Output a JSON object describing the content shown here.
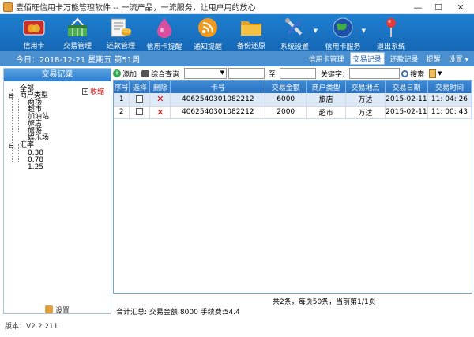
{
  "window": {
    "title": "壹佰旺信用卡万能管理软件 -- 一流产品，一流服务，让用户用的放心",
    "minimize": "—",
    "maximize": "☐",
    "close": "✕"
  },
  "toolbar": {
    "items": [
      {
        "label": "信用卡",
        "icon": "credit-card-icon",
        "has_menu": false
      },
      {
        "label": "交易管理",
        "icon": "shopping-basket-icon",
        "has_menu": false
      },
      {
        "label": "还款管理",
        "icon": "bill-coins-icon",
        "has_menu": false
      },
      {
        "label": "信用卡提醒",
        "icon": "drop-icon",
        "has_menu": false
      },
      {
        "label": "通知提醒",
        "icon": "rss-icon",
        "has_menu": false
      },
      {
        "label": "备份还原",
        "icon": "folder-icon",
        "has_menu": false
      },
      {
        "label": "系统设置",
        "icon": "tools-icon",
        "has_menu": true
      },
      {
        "label": "信用卡服务",
        "icon": "globe-icon",
        "has_menu": true
      },
      {
        "label": "退出系统",
        "icon": "pin-icon",
        "has_menu": false
      }
    ]
  },
  "infobar": {
    "date": "今日：2018-12-21 星期五 第51周",
    "links": [
      {
        "label": "信用卡管理",
        "active": false
      },
      {
        "label": "交易记录",
        "active": true
      },
      {
        "label": "还款记录",
        "active": false
      },
      {
        "label": "提醒",
        "active": false
      },
      {
        "label": "设置 ▾",
        "active": false
      }
    ]
  },
  "sidebar": {
    "header": "交易记录",
    "collapse_label": "收缩",
    "tree": {
      "all": "全部",
      "merchant_type": "商户类型",
      "merchants": [
        "商场",
        "超市",
        "加油站",
        "旅店",
        "旅游",
        "娱乐场"
      ],
      "rate": "汇率",
      "rates": [
        "0.38",
        "0.78",
        "1.25"
      ]
    },
    "settings_label": "设置"
  },
  "searchbar": {
    "add_label": "添加",
    "query_label": "综合查询",
    "to_label": "至",
    "keyword_label": "关键字：",
    "search_label": "搜索"
  },
  "table": {
    "columns": [
      "序号",
      "选择",
      "删除",
      "卡号",
      "交易金额",
      "商户类型",
      "交易地点",
      "交易日期",
      "交易时间"
    ],
    "rows": [
      {
        "no": "1",
        "card": "4062540301082212",
        "amount": "6000",
        "type": "旅店",
        "place": "万达",
        "date": "2015-02-11",
        "time": "11: 04: 26"
      },
      {
        "no": "2",
        "card": "4062540301082212",
        "amount": "2000",
        "type": "超市",
        "place": "万达",
        "date": "2015-02-11",
        "time": "11: 00: 43"
      }
    ]
  },
  "pager": "共2条，每页50条，当前第1/1页",
  "summary": "合计汇总: 交易金额:8000   手续费:54.4",
  "version": "版本：V2.2.211"
}
